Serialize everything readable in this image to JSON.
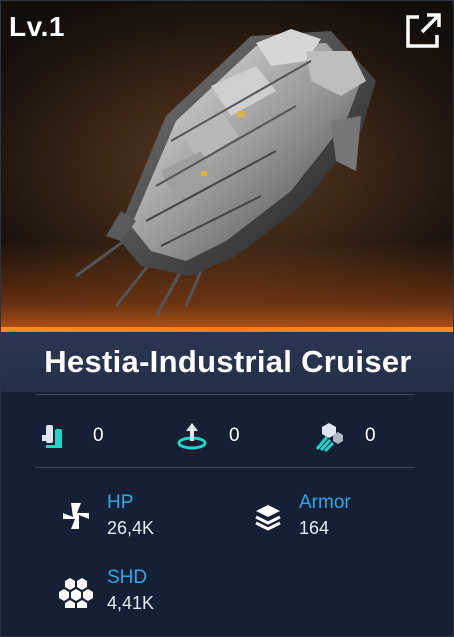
{
  "card": {
    "level": "Lv.1",
    "ship_name": "Hestia-Industrial Cruiser",
    "expand_icon": "expand-icon",
    "accent_color": "#ff8a1e"
  },
  "modules": [
    {
      "icon": "weapon-module-icon",
      "value": "0"
    },
    {
      "icon": "support-module-icon",
      "value": "0"
    },
    {
      "icon": "drone-module-icon",
      "value": "0"
    }
  ],
  "stats": {
    "hp": {
      "label": "HP",
      "value": "26,4K",
      "icon": "repair-cross-icon"
    },
    "armor": {
      "label": "Armor",
      "value": "164",
      "icon": "armor-layers-icon"
    },
    "shd": {
      "label": "SHD",
      "value": "4,41K",
      "icon": "shield-hex-icon"
    }
  }
}
